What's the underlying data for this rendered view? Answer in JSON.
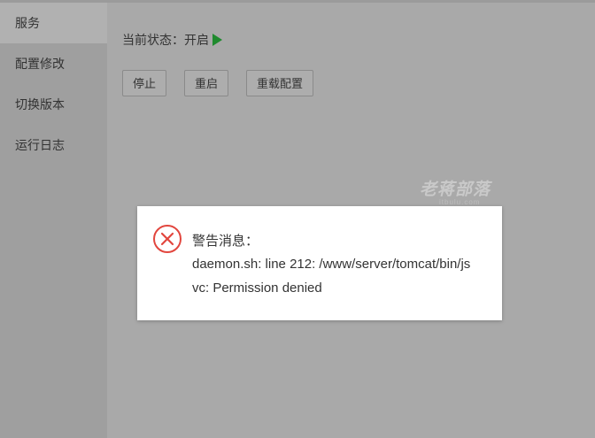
{
  "sidebar": {
    "items": [
      {
        "label": "服务",
        "active": true
      },
      {
        "label": "配置修改",
        "active": false
      },
      {
        "label": "切换版本",
        "active": false
      },
      {
        "label": "运行日志",
        "active": false
      }
    ]
  },
  "main": {
    "status_label": "当前状态：开启",
    "status_icon": "play-icon",
    "buttons": {
      "stop": "停止",
      "restart": "重启",
      "reload": "重载配置"
    }
  },
  "watermark": {
    "text": "老蒋部落",
    "sub": "itbulu.com"
  },
  "dialog": {
    "icon": "error-circle-icon",
    "title": "警告消息：",
    "message": "daemon.sh: line 212: /www/server/tomcat/bin/jsvc: Permission denied",
    "icon_color": "#e2463e"
  }
}
